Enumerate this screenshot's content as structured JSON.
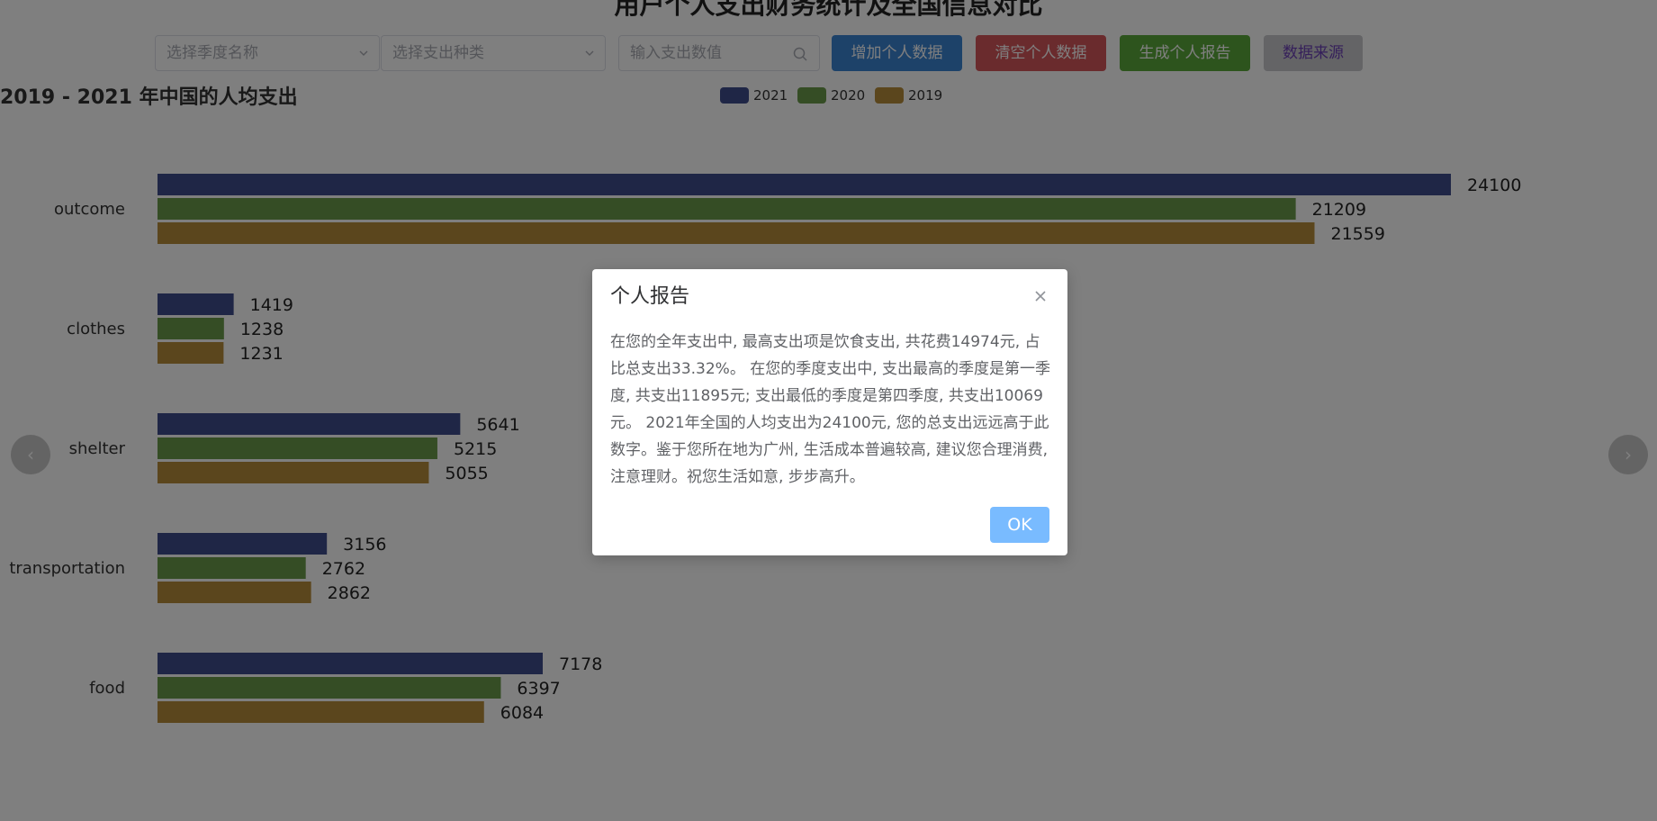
{
  "header": {
    "title": "用户个人支出财务统计及全国信息对比"
  },
  "controls": {
    "season_placeholder": "选择季度名称",
    "category_placeholder": "选择支出种类",
    "amount_placeholder": "输入支出数值",
    "add_label": "增加个人数据",
    "clear_label": "清空个人数据",
    "report_label": "生成个人报告",
    "source_label": "数据来源"
  },
  "colors": {
    "add": "#3a84d3",
    "clear": "#d5565b",
    "report": "#5aa83a",
    "source": "#c8c9cc",
    "source_text": "#6a3fb4",
    "y2021": "#3f4c8c",
    "y2020": "#6a9a4a",
    "y2019": "#b78c3a"
  },
  "carousel": {
    "prev_icon": "chevron-left-icon",
    "next_icon": "chevron-right-icon"
  },
  "chart_data": {
    "type": "bar",
    "orientation": "horizontal",
    "title": "2019 - 2021 年中国的人均支出",
    "categories": [
      "outcome",
      "clothes",
      "shelter",
      "transportation",
      "food"
    ],
    "series": [
      {
        "name": "2021",
        "values": [
          24100,
          1419,
          5641,
          3156,
          7178
        ]
      },
      {
        "name": "2020",
        "values": [
          21209,
          1238,
          5215,
          2762,
          6397
        ]
      },
      {
        "name": "2019",
        "values": [
          21559,
          1231,
          5055,
          2862,
          6084
        ]
      }
    ],
    "xlim": [
      0,
      24100
    ],
    "legend": "top-center",
    "grid": false,
    "data_labels": true
  },
  "dialog": {
    "title": "个人报告",
    "body": "在您的全年支出中, 最高支出项是饮食支出, 共花费14974元, 占比总支出33.32%。 在您的季度支出中, 支出最高的季度是第一季度, 共支出11895元; 支出最低的季度是第四季度, 共支出10069元。 2021年全国的人均支出为24100元, 您的总支出远远高于此数字。鉴于您所在地为广州, 生活成本普遍较高, 建议您合理消费, 注意理财。祝您生活如意, 步步高升。",
    "ok_label": "OK"
  }
}
